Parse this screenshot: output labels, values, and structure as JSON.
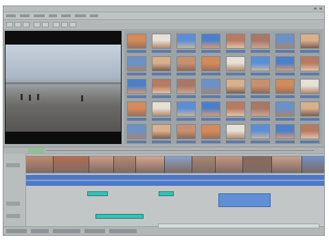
{
  "app": {
    "title": ""
  },
  "colors": {
    "window_bg": "#a9aeb0",
    "timeline_bg": "#c2c6c6",
    "audio_track": "#4f78c4",
    "teal_clip": "#34c2b8",
    "selection_blue": "#5f8fd4"
  },
  "menu": {
    "items": [
      "",
      "",
      "",
      "",
      "",
      "",
      ""
    ]
  },
  "toolbar": {
    "buttons": [
      "",
      "",
      "",
      "",
      "",
      "",
      "",
      ""
    ]
  },
  "media": {
    "thumbnail_count": 40
  },
  "timeline": {
    "tracks": [
      "",
      "",
      ""
    ]
  },
  "status": {
    "text": ""
  }
}
